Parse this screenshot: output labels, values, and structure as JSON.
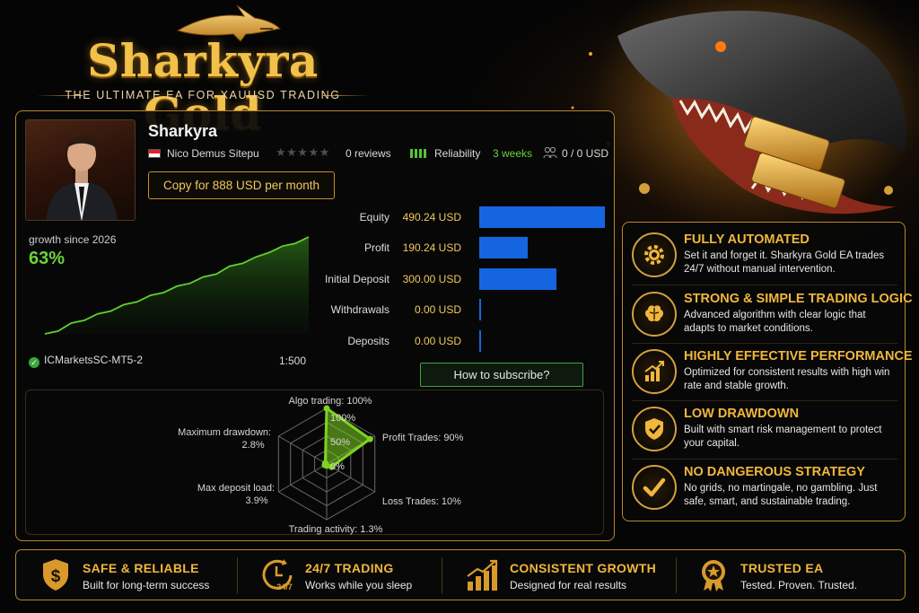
{
  "brand": {
    "title": "Sharkyra Gold",
    "subtitle": "THE ULTIMATE EA FOR XAUUSD TRADING"
  },
  "signal": {
    "name": "Sharkyra",
    "author": "Nico Demus Sitepu",
    "rating_stars": 0,
    "reviews": "0 reviews",
    "reliability_label": "Reliability",
    "reliability_level": 4,
    "weeks": "3 weeks",
    "subscribers": "0 / 0 USD",
    "copy_button": "Copy for 888 USD per month",
    "growth_label": "growth since 2026",
    "growth_value": "63%",
    "server": "ICMarketsSC-MT5-2",
    "leverage": "1:500",
    "subscribe_button": "How to subscribe?"
  },
  "financials": [
    {
      "label": "Equity",
      "value": "490.24 USD",
      "amount": 490.24
    },
    {
      "label": "Profit",
      "value": "190.24 USD",
      "amount": 190.24
    },
    {
      "label": "Initial Deposit",
      "value": "300.00 USD",
      "amount": 300.0
    },
    {
      "label": "Withdrawals",
      "value": "0.00 USD",
      "amount": 0
    },
    {
      "label": "Deposits",
      "value": "0.00 USD",
      "amount": 0
    }
  ],
  "radar": {
    "axes": [
      {
        "label": "Algo trading: 100%",
        "value": 100
      },
      {
        "label": "Profit Trades: 90%",
        "value": 90
      },
      {
        "label": "Loss Trades: 10%",
        "value": 10
      },
      {
        "label": "Trading activity: 1.3%",
        "value": 1.3
      },
      {
        "label": "Max deposit load:",
        "sublabel": "3.9%",
        "value": 3.9
      },
      {
        "label": "Maximum drawdown:",
        "sublabel": "2.8%",
        "value": 2.8
      }
    ],
    "ticks": [
      "100%",
      "50%",
      "0%"
    ],
    "color": "#7ed321"
  },
  "features": [
    {
      "icon": "gear-icon",
      "title": "FULLY AUTOMATED",
      "desc": "Set it and forget it. Sharkyra Gold EA trades 24/7 without manual intervention."
    },
    {
      "icon": "brain-icon",
      "title": "STRONG & SIMPLE TRADING LOGIC",
      "desc": "Advanced algorithm with clear logic that adapts to market conditions."
    },
    {
      "icon": "growth-chart-icon",
      "title": "HIGHLY EFFECTIVE PERFORMANCE",
      "desc": "Optimized for consistent results with high win rate and stable growth."
    },
    {
      "icon": "shield-check-icon",
      "title": "LOW DRAWDOWN",
      "desc": "Built with smart risk management to protect your capital."
    },
    {
      "icon": "checkmark-icon",
      "title": "NO DANGEROUS STRATEGY",
      "desc": "No grids, no martingale, no gambling. Just safe, smart, and sustainable trading."
    }
  ],
  "bottom": [
    {
      "icon": "shield-dollar-icon",
      "title": "SAFE & RELIABLE",
      "desc": "Built for long-term success"
    },
    {
      "icon": "clock-24-7-icon",
      "title": "24/7 TRADING",
      "desc": "Works while you sleep",
      "icon_text": "24/7"
    },
    {
      "icon": "bar-growth-icon",
      "title": "CONSISTENT GROWTH",
      "desc": "Designed for real results"
    },
    {
      "icon": "star-badge-icon",
      "title": "TRUSTED EA",
      "desc": "Tested. Proven. Trusted."
    }
  ],
  "colors": {
    "gold": "#f0b73c",
    "border_gold": "#b8862f",
    "accent_green": "#6bd23c",
    "bar_blue": "#1565e0"
  },
  "chart_data": {
    "type": "area",
    "title": "growth since 2026",
    "x": [
      0,
      1,
      2,
      3,
      4,
      5,
      6,
      7,
      8,
      9,
      10,
      11,
      12,
      13,
      14,
      15,
      16,
      17,
      18,
      19,
      20
    ],
    "values": [
      0,
      3,
      7,
      10,
      13,
      16,
      19,
      22,
      25,
      28,
      31,
      34,
      37,
      40,
      44,
      47,
      50,
      54,
      57,
      60,
      63
    ],
    "ylabel": "",
    "ylim": [
      0,
      70
    ]
  }
}
